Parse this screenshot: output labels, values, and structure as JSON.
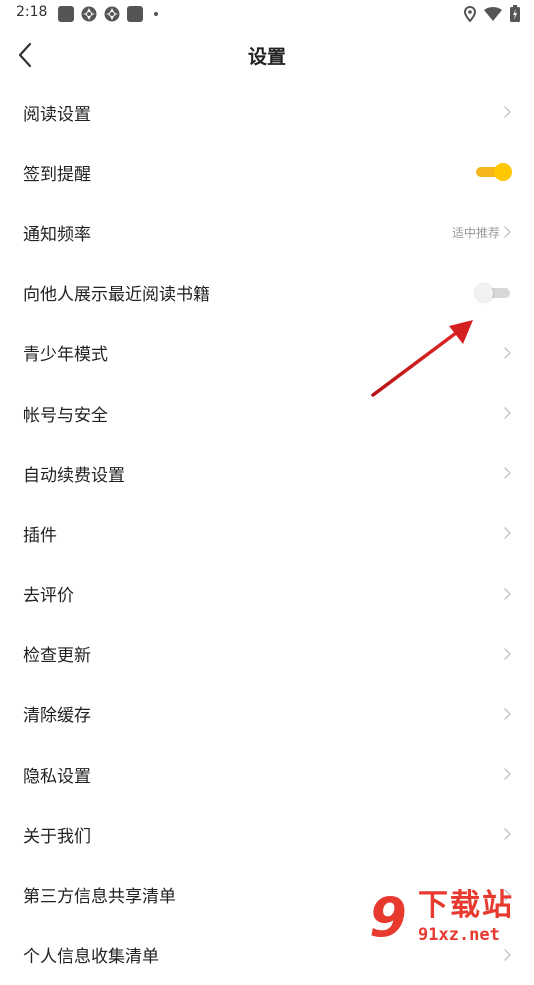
{
  "status_bar": {
    "time": "2:18",
    "icons": [
      "notification-square-icon",
      "aperture-icon",
      "aperture-icon",
      "notification-square-icon",
      "more-dot-icon",
      "location-icon",
      "wifi-icon",
      "battery-icon"
    ]
  },
  "header": {
    "title": "设置",
    "back_icon": "chevron-left-icon"
  },
  "rows": [
    {
      "label": "阅读设置",
      "type": "link"
    },
    {
      "label": "签到提醒",
      "type": "toggle",
      "on": true
    },
    {
      "label": "通知频率",
      "type": "link",
      "value": "适中推荐"
    },
    {
      "label": "向他人展示最近阅读书籍",
      "type": "toggle",
      "on": false
    },
    {
      "label": "青少年模式",
      "type": "link"
    },
    {
      "label": "帐号与安全",
      "type": "link"
    },
    {
      "label": "自动续费设置",
      "type": "link"
    },
    {
      "label": "插件",
      "type": "link"
    },
    {
      "label": "去评价",
      "type": "link"
    },
    {
      "label": "检查更新",
      "type": "link"
    },
    {
      "label": "清除缓存",
      "type": "link"
    },
    {
      "label": "隐私设置",
      "type": "link"
    },
    {
      "label": "关于我们",
      "type": "link"
    },
    {
      "label": "第三方信息共享清单",
      "type": "link"
    },
    {
      "label": "个人信息收集清单",
      "type": "link"
    }
  ],
  "watermark": {
    "nine": "9",
    "main": "下载站",
    "site": "91xz.net"
  },
  "colors": {
    "toggle_on": "#f6b51b",
    "toggle_knob_on": "#ffc800",
    "annotation_arrow": "#d42020",
    "watermark": "#e8392f"
  }
}
